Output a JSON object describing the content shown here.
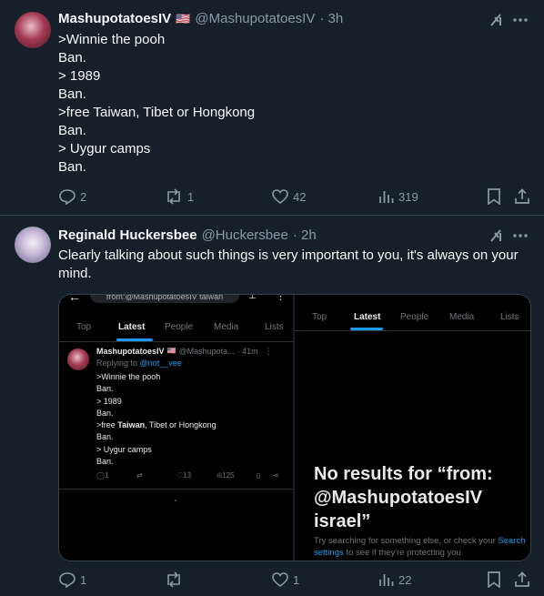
{
  "tweet1": {
    "name": "MashupotatoesIV",
    "flag": "🇺🇸",
    "handle": "@MashupotatoesIV",
    "time": "· 3h",
    "lines": [
      ">Winnie the pooh",
      "Ban.",
      "> 1989",
      "Ban.",
      ">free Taiwan, Tibet or Hongkong",
      "Ban.",
      "> Uygur camps",
      "Ban."
    ],
    "actions": {
      "replies": "2",
      "retweets": "1",
      "likes": "42",
      "views": "319"
    }
  },
  "tweet2": {
    "name": "Reginald Huckersbee",
    "handle": "@Huckersbee",
    "time": "· 2h",
    "text": "Clearly talking about such things is very important to you, it's always on your mind.",
    "actions": {
      "replies": "1",
      "retweets": "",
      "likes": "1",
      "views": "22"
    }
  },
  "left_shot": {
    "search_text": "from:@MashupotatoesIV taiwan",
    "tabs": [
      "Top",
      "Latest",
      "People",
      "Media",
      "Lists"
    ],
    "tweet": {
      "name": "MashupotatoesIV",
      "handle": "@Mashupota...",
      "time": "· 41m",
      "replying_label": "Replying to",
      "replying_handle": "@not__vee",
      "lines": [
        ">Winnie the pooh",
        "Ban.",
        "> 1989",
        "Ban."
      ],
      "taiwan_prefix": ">free ",
      "taiwan_bold": "Taiwan",
      "taiwan_suffix": ", Tibet or Hongkong",
      "lines2": [
        "Ban.",
        "> Uygur camps",
        "Ban."
      ],
      "actions": {
        "replies": "1",
        "likes": "13",
        "views": "125"
      }
    }
  },
  "right_shot": {
    "tabs": [
      "Top",
      "Latest",
      "People",
      "Media",
      "Lists"
    ],
    "no_results": "No results for “from: @MashupotatoesIV israel”",
    "hint_text": "Try searching for something else, or check your",
    "hint_link": "Search settings",
    "hint_rest": "to see if they're protecting you"
  },
  "colors": {
    "bg": "#15202b",
    "muted": "#8b98a5",
    "accent": "#1d9bf0",
    "divider": "#38444d"
  }
}
